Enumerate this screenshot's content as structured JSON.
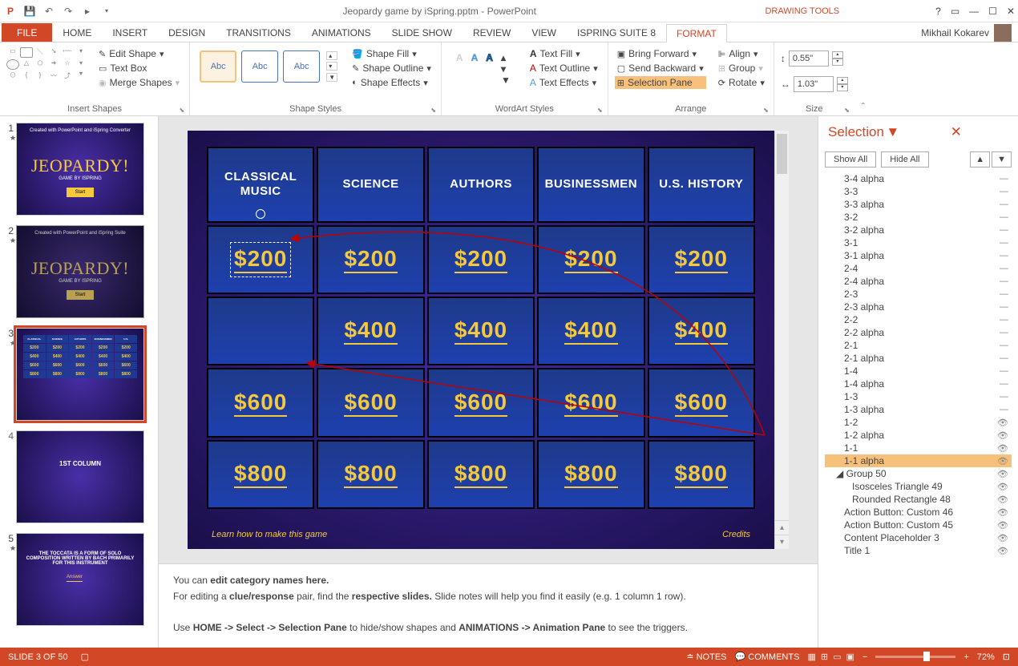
{
  "title": "Jeopardy game by iSpring.pptm - PowerPoint",
  "tools_context": "DRAWING TOOLS",
  "user": "Mikhail Kokarev",
  "tabs": [
    "FILE",
    "HOME",
    "INSERT",
    "DESIGN",
    "TRANSITIONS",
    "ANIMATIONS",
    "SLIDE SHOW",
    "REVIEW",
    "VIEW",
    "ISPRING SUITE 8",
    "FORMAT"
  ],
  "ribbon": {
    "insert_shapes": {
      "label": "Insert Shapes",
      "edit_shape": "Edit Shape",
      "text_box": "Text Box",
      "merge_shapes": "Merge Shapes"
    },
    "shape_styles": {
      "label": "Shape Styles",
      "swatch": "Abc",
      "fill": "Shape Fill",
      "outline": "Shape Outline",
      "effects": "Shape Effects"
    },
    "wordart": {
      "label": "WordArt Styles",
      "fill": "Text Fill",
      "outline": "Text Outline",
      "effects": "Text Effects"
    },
    "arrange": {
      "label": "Arrange",
      "forward": "Bring Forward",
      "backward": "Send Backward",
      "selection": "Selection Pane",
      "align": "Align",
      "group": "Group",
      "rotate": "Rotate"
    },
    "size": {
      "label": "Size",
      "height": "0.55\"",
      "width": "1.03\""
    }
  },
  "thumbs": [
    {
      "n": "1",
      "type": "title",
      "top": "Created with PowerPoint and iSpring Converter",
      "title": "JEOPARDY!",
      "sub": "GAME BY ISPRING",
      "btn": "Start"
    },
    {
      "n": "2",
      "type": "title",
      "top": "Created with PowerPoint and iSpring Suite",
      "title": "JEOPARDY!",
      "sub": "GAME BY ISPRING",
      "btn": "Start"
    },
    {
      "n": "3",
      "type": "board"
    },
    {
      "n": "4",
      "type": "text",
      "text": "1ST COLUMN"
    },
    {
      "n": "5",
      "type": "text",
      "text": "THE TOCCATA IS A FORM OF SOLO COMPOSITION WRITTEN BY BACH PRIMARILY FOR THIS INSTRUMENT",
      "btn": "Answer"
    }
  ],
  "board": {
    "categories": [
      "CLASSICAL MUSIC",
      "SCIENCE",
      "AUTHORS",
      "BUSINESSMEN",
      "U.S. HISTORY"
    ],
    "values": [
      "$200",
      "$400",
      "$600",
      "$800"
    ],
    "learn": "Learn how to make this game",
    "credits": "Credits"
  },
  "notes": {
    "l1a": "You can ",
    "l1b": "edit category names here.",
    "l2a": "For editing a ",
    "l2b": "clue/response",
    "l2c": " pair, find the ",
    "l2d": "respective slides.",
    "l2e": " Slide notes will help you find it easily (e.g. 1 column 1 row).",
    "l3a": "Use ",
    "l3b": "HOME -> Select -> Selection Pane",
    "l3c": " to hide/show shapes and ",
    "l3d": "ANIMATIONS -> Animation Pane",
    "l3e": " to see the triggers."
  },
  "selpane": {
    "title": "Selection",
    "show": "Show All",
    "hide": "Hide All",
    "items": [
      {
        "t": "3-4 alpha",
        "i": 1
      },
      {
        "t": "3-3",
        "i": 1
      },
      {
        "t": "3-3 alpha",
        "i": 1
      },
      {
        "t": "3-2",
        "i": 1
      },
      {
        "t": "3-2 alpha",
        "i": 1
      },
      {
        "t": "3-1",
        "i": 1
      },
      {
        "t": "3-1 alpha",
        "i": 1
      },
      {
        "t": "2-4",
        "i": 1
      },
      {
        "t": "2-4 alpha",
        "i": 1
      },
      {
        "t": "2-3",
        "i": 1
      },
      {
        "t": "2-3 alpha",
        "i": 1
      },
      {
        "t": "2-2",
        "i": 1
      },
      {
        "t": "2-2 alpha",
        "i": 1
      },
      {
        "t": "2-1",
        "i": 1
      },
      {
        "t": "2-1 alpha",
        "i": 1
      },
      {
        "t": "1-4",
        "i": 1
      },
      {
        "t": "1-4 alpha",
        "i": 1
      },
      {
        "t": "1-3",
        "i": 1
      },
      {
        "t": "1-3 alpha",
        "i": 1
      },
      {
        "t": "1-2",
        "i": 1,
        "eye": true
      },
      {
        "t": "1-2 alpha",
        "i": 1,
        "eye": true
      },
      {
        "t": "1-1",
        "i": 1,
        "eye": true
      },
      {
        "t": "1-1 alpha",
        "i": 1,
        "sel": true,
        "eye": true
      },
      {
        "t": "Group 50",
        "i": 0,
        "eye": true,
        "caret": true
      },
      {
        "t": "Isosceles Triangle 49",
        "i": 2,
        "eye": true
      },
      {
        "t": "Rounded Rectangle 48",
        "i": 2,
        "eye": true
      },
      {
        "t": "Action Button: Custom 46",
        "i": 1,
        "eye": true
      },
      {
        "t": "Action Button: Custom 45",
        "i": 1,
        "eye": true
      },
      {
        "t": "Content Placeholder 3",
        "i": 1,
        "eye": true
      },
      {
        "t": "Title 1",
        "i": 1,
        "eye": true
      }
    ]
  },
  "status": {
    "slide": "SLIDE 3 OF 50",
    "notes": "NOTES",
    "comments": "COMMENTS",
    "zoom": "72%"
  }
}
